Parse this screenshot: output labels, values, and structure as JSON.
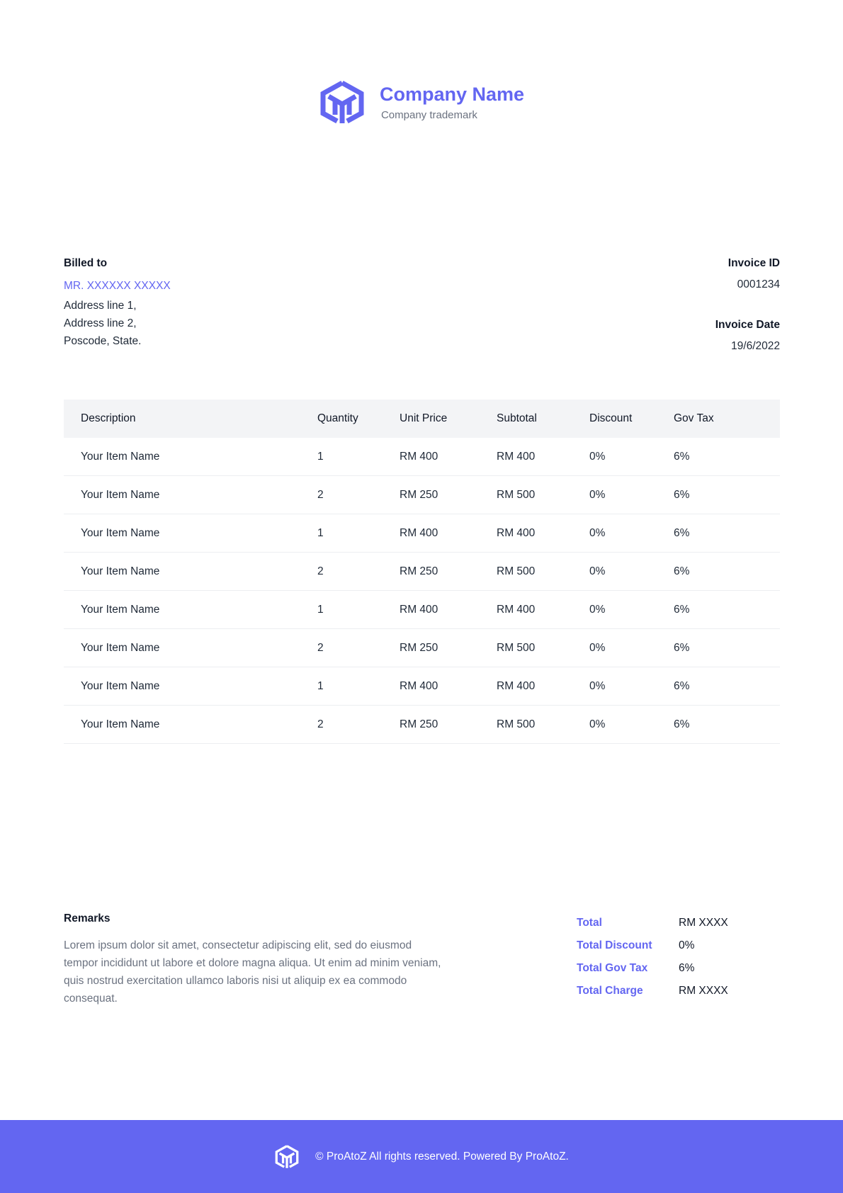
{
  "brand": {
    "name": "Company Name",
    "trademark": "Company trademark",
    "color": "#6366f1"
  },
  "billed": {
    "label": "Billed to",
    "client": "MR. XXXXXX XXXXX",
    "address": [
      "Address line 1,",
      "Address line 2,",
      "Poscode, State."
    ]
  },
  "invoice": {
    "id_label": "Invoice ID",
    "id": "0001234",
    "date_label": "Invoice Date",
    "date": "19/6/2022"
  },
  "table": {
    "headers": [
      "Description",
      "Quantity",
      "Unit Price",
      "Subtotal",
      "Discount",
      "Gov Tax"
    ],
    "rows": [
      [
        "Your Item Name",
        "1",
        "RM 400",
        "RM 400",
        "0%",
        "6%"
      ],
      [
        "Your Item Name",
        "2",
        "RM 250",
        "RM 500",
        "0%",
        "6%"
      ],
      [
        "Your Item Name",
        "1",
        "RM 400",
        "RM 400",
        "0%",
        "6%"
      ],
      [
        "Your Item Name",
        "2",
        "RM 250",
        "RM 500",
        "0%",
        "6%"
      ],
      [
        "Your Item Name",
        "1",
        "RM 400",
        "RM 400",
        "0%",
        "6%"
      ],
      [
        "Your Item Name",
        "2",
        "RM 250",
        "RM 500",
        "0%",
        "6%"
      ],
      [
        "Your Item Name",
        "1",
        "RM 400",
        "RM 400",
        "0%",
        "6%"
      ],
      [
        "Your Item Name",
        "2",
        "RM 250",
        "RM 500",
        "0%",
        "6%"
      ]
    ]
  },
  "remarks": {
    "label": "Remarks",
    "text": "Lorem ipsum dolor sit amet, consectetur adipiscing elit, sed do eiusmod tempor incididunt ut labore et dolore magna aliqua. Ut enim ad minim veniam, quis nostrud exercitation ullamco laboris nisi ut aliquip ex ea commodo consequat."
  },
  "totals": [
    {
      "label": "Total",
      "value": "RM XXXX"
    },
    {
      "label": "Total Discount",
      "value": "0%"
    },
    {
      "label": "Total Gov Tax",
      "value": "6%"
    },
    {
      "label": "Total Charge",
      "value": "RM XXXX"
    }
  ],
  "footer": {
    "text": "© ProAtoZ All rights reserved. Powered By ProAtoZ."
  },
  "icons": {
    "logo": "cube-logo-icon"
  }
}
